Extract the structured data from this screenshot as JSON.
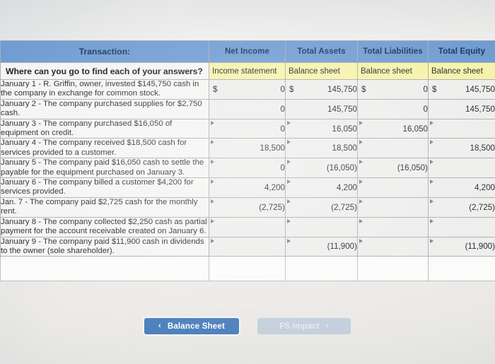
{
  "table": {
    "headers": {
      "transaction": "Transaction:",
      "net_income": "Net Income",
      "total_assets": "Total Assets",
      "total_liabilities": "Total Liabilities",
      "total_equity": "Total Equity"
    },
    "reference_row": {
      "question": "Where can you go to find each of your answers?",
      "net_income": "Income statement",
      "total_assets": "Balance sheet",
      "total_liabilities": "Balance sheet",
      "total_equity": "Balance sheet"
    },
    "currency_symbol": "$",
    "rows": [
      {
        "description": "January 1 - R. Griffin, owner, invested $145,750 cash in the company in exchange for common stock.",
        "net_income": "0",
        "total_assets": "145,750",
        "total_liabilities": "0",
        "total_equity": "145,750",
        "show_currency": true,
        "markers": false
      },
      {
        "description": "January 2 - The company purchased supplies for $2,750 cash.",
        "net_income": "0",
        "total_assets": "145,750",
        "total_liabilities": "0",
        "total_equity": "145,750",
        "show_currency": false,
        "markers": false
      },
      {
        "description": "January 3 - The company purchased $16,050 of equipment on credit.",
        "net_income": "0",
        "total_assets": "16,050",
        "total_liabilities": "16,050",
        "total_equity": "",
        "show_currency": false,
        "markers": true
      },
      {
        "description": "January 4 - The company received $18,500 cash for services provided to a customer.",
        "net_income": "18,500",
        "total_assets": "18,500",
        "total_liabilities": "",
        "total_equity": "18,500",
        "show_currency": false,
        "markers": true
      },
      {
        "description": "January 5 - The company paid $16,050 cash to settle the payable for the equipment purchased on January 3.",
        "net_income": "0",
        "total_assets": "(16,050)",
        "total_liabilities": "(16,050)",
        "total_equity": "",
        "show_currency": false,
        "markers": true
      },
      {
        "description": "January 6 - The company billed a customer $4,200 for services provided.",
        "net_income": "4,200",
        "total_assets": "4,200",
        "total_liabilities": "",
        "total_equity": "4,200",
        "show_currency": false,
        "markers": true
      },
      {
        "description": "Jan. 7 - The company paid $2,725 cash for the monthly rent.",
        "net_income": "(2,725)",
        "total_assets": "(2,725)",
        "total_liabilities": "",
        "total_equity": "(2,725)",
        "show_currency": false,
        "markers": true
      },
      {
        "description": "January 8 - The company collected $2,250 cash as partial payment for the account receivable created on January 6.",
        "net_income": "",
        "total_assets": "",
        "total_liabilities": "",
        "total_equity": "",
        "show_currency": false,
        "markers": true
      },
      {
        "description": "January 9 - The company paid $11,900 cash in dividends to the owner (sole shareholder).",
        "net_income": "",
        "total_assets": "(11,900)",
        "total_liabilities": "",
        "total_equity": "(11,900)",
        "show_currency": false,
        "markers": true
      }
    ]
  },
  "navigation": {
    "prev_label": "Balance Sheet",
    "prev_chevron": "‹",
    "next_label": "FS Impact",
    "next_chevron": "›"
  },
  "colors": {
    "header_blue": "#6e9bd1",
    "reference_yellow": "#f6f2a8",
    "active_button": "#4a7ebb",
    "disabled_button": "#c3cfdb"
  }
}
